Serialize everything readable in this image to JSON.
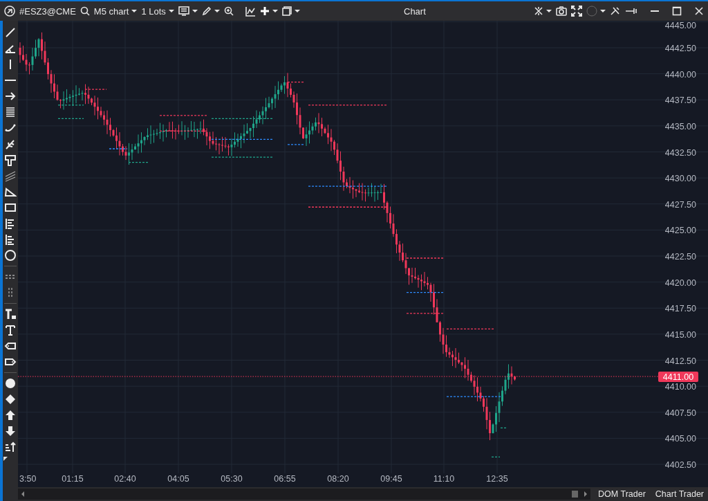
{
  "toolbar": {
    "symbol": "#ESZ3@CME",
    "timeframe": "M5 chart",
    "quantity": "1 Lots"
  },
  "window": {
    "title": "Chart"
  },
  "chart": {
    "price_labels": [
      "4445.00",
      "4442.50",
      "4440.00",
      "4437.50",
      "4435.00",
      "4432.50",
      "4430.00",
      "4427.50",
      "4425.00",
      "4422.50",
      "4420.00",
      "4417.50",
      "4415.00",
      "4412.50",
      "4410.00",
      "4407.50",
      "4405.00",
      "4402.50"
    ],
    "time_labels": [
      "3:50",
      "01:15",
      "02:40",
      "04:05",
      "05:30",
      "06:55",
      "08:20",
      "09:45",
      "11:10",
      "12:35"
    ],
    "current_price": "4411.00"
  },
  "bottom_tabs": [
    {
      "label": "DOM Trader",
      "selected": false
    },
    {
      "label": "Chart Trader",
      "selected": false
    }
  ]
}
